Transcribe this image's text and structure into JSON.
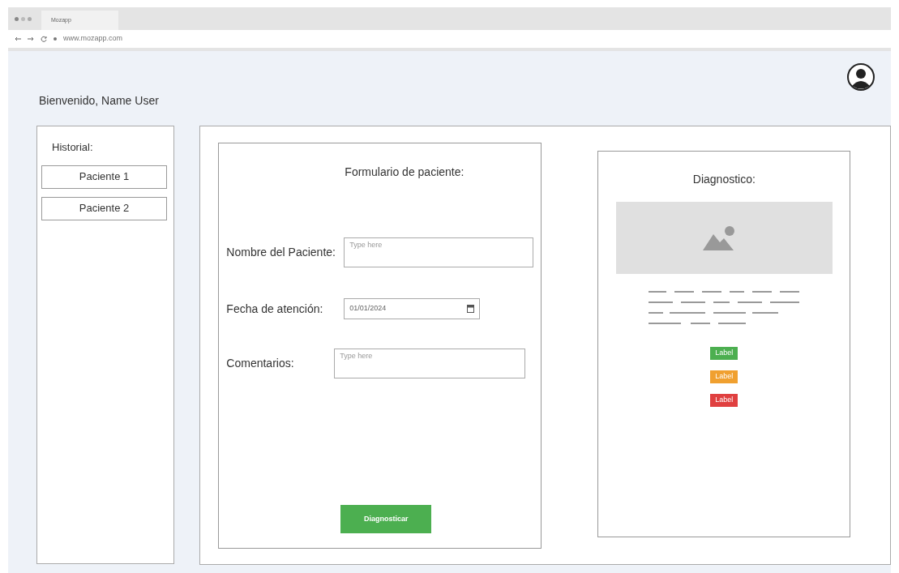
{
  "browser": {
    "tab_title": "Mozapp",
    "url": "www.mozapp.com"
  },
  "welcome": "Bienvenido, Name User",
  "sidebar": {
    "title": "Historial:",
    "items": [
      {
        "label": "Paciente 1"
      },
      {
        "label": "Paciente 2"
      }
    ]
  },
  "form": {
    "title": "Formulario de paciente:",
    "fields": [
      {
        "kind": "text",
        "label": "Nombre del Paciente:",
        "placeholder": "Type here"
      },
      {
        "kind": "date",
        "label": "Fecha de atención:",
        "value": "01/01/2024"
      },
      {
        "kind": "text",
        "label": "Comentarios:",
        "placeholder": "Type here"
      }
    ],
    "submit": "Diagnosticar"
  },
  "diagnosis": {
    "title": "Diagnostico:",
    "labels": [
      {
        "text": "Label",
        "color": "#4caf50"
      },
      {
        "text": "Label",
        "color": "#f0a030"
      },
      {
        "text": "Label",
        "color": "#e04040"
      }
    ]
  }
}
